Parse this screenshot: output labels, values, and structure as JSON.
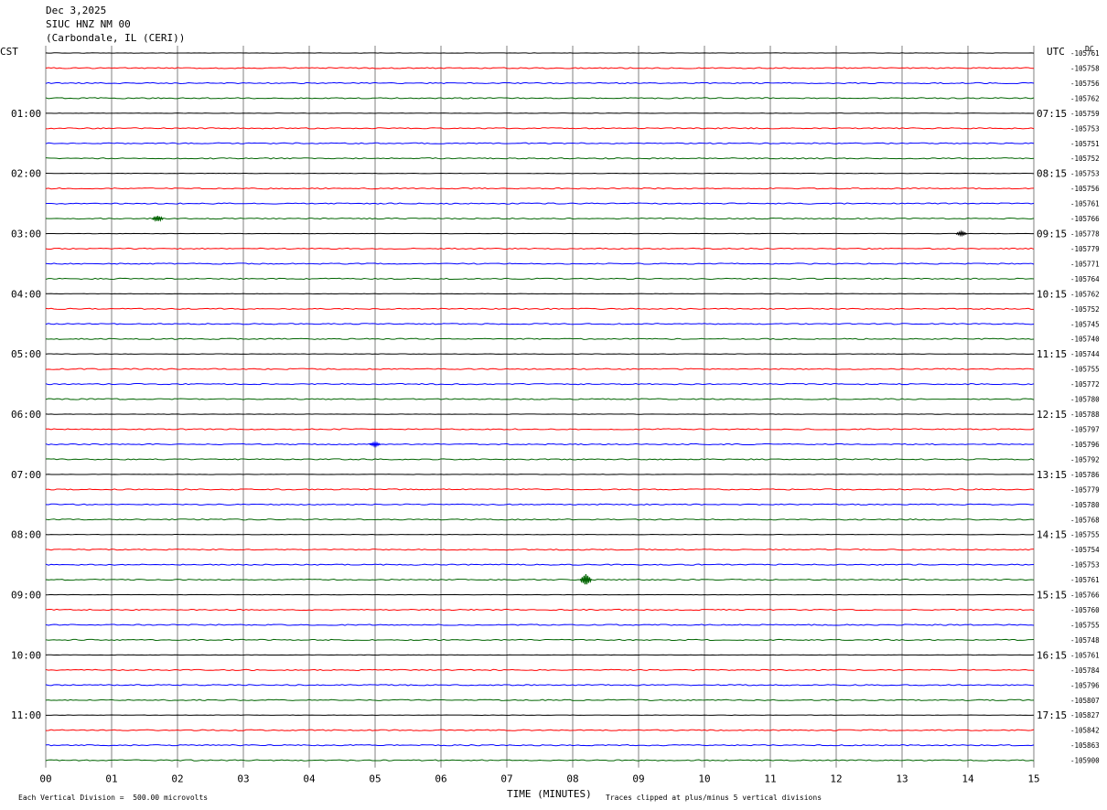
{
  "header": {
    "date": "Dec 3,2025",
    "station": "SIUC HNZ NM 00",
    "location": "(Carbondale, IL (CERI))"
  },
  "axis": {
    "left_title": "CST",
    "right_title": "UTC",
    "dc_title": "DC",
    "x_title": "TIME (MINUTES)",
    "footer_left": "Each Vertical Division =  500.00 microvolts",
    "footer_right": "Traces clipped at plus/minus 5 vertical divisions"
  },
  "colors": {
    "cycle": [
      "#000000",
      "#ff0000",
      "#0000ff",
      "#006400"
    ],
    "grid": "#808080"
  },
  "chart_data": {
    "type": "line",
    "title": "SIUC HNZ NM 00",
    "xlabel": "TIME (MINUTES)",
    "x_ticks": [
      "00",
      "01",
      "02",
      "03",
      "04",
      "05",
      "06",
      "07",
      "08",
      "09",
      "10",
      "11",
      "12",
      "13",
      "14",
      "15"
    ],
    "xlim": [
      0,
      15
    ],
    "minutes_per_trace": 15,
    "num_traces": 48,
    "cst_labels": [
      "01:00",
      "02:00",
      "03:00",
      "04:00",
      "05:00",
      "06:00",
      "07:00",
      "08:00",
      "09:00",
      "10:00",
      "11:00"
    ],
    "utc_labels": [
      "07:15",
      "08:15",
      "09:15",
      "10:15",
      "11:15",
      "12:15",
      "13:15",
      "14:15",
      "15:15",
      "16:15",
      "17:15"
    ],
    "dc_offsets": [
      "-105761",
      "-105758",
      "-105756",
      "-105762",
      "-105759",
      "-105753",
      "-105751",
      "-105752",
      "-105753",
      "-105756",
      "-105761",
      "-105766",
      "-105778",
      "-105779",
      "-105771",
      "-105764",
      "-105762",
      "-105752",
      "-105745",
      "-105740",
      "-105744",
      "-105755",
      "-105772",
      "-105780",
      "-105788",
      "-105797",
      "-105796",
      "-105792",
      "-105786",
      "-105779",
      "-105780",
      "-105768",
      "-105755",
      "-105754",
      "-105753",
      "-105761",
      "-105766",
      "-105760",
      "-105755",
      "-105748",
      "-105761",
      "-105784",
      "-105796",
      "-105807",
      "-105827",
      "-105842",
      "-105863",
      "-105900"
    ],
    "events": [
      {
        "trace": 35,
        "minute": 8.2,
        "amplitude": 6
      },
      {
        "trace": 11,
        "minute": 1.7,
        "amplitude": 3
      },
      {
        "trace": 12,
        "minute": 13.9,
        "amplitude": 2
      },
      {
        "trace": 26,
        "minute": 5.0,
        "amplitude": 2
      }
    ]
  }
}
